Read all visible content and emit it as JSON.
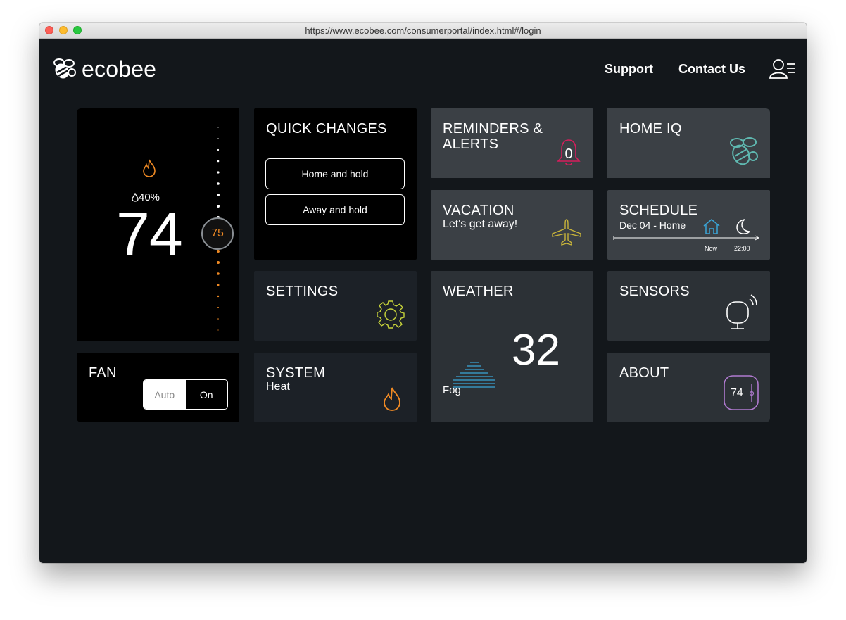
{
  "browser": {
    "url": "https://www.ecobee.com/consumerportal/index.html#/login"
  },
  "header": {
    "brand": "ecobee",
    "links": {
      "support": "Support",
      "contact": "Contact Us"
    },
    "icons": {
      "logo": "bee-logo-icon",
      "user": "user-menu-icon"
    }
  },
  "thermostat": {
    "current_temp": "74",
    "humidity": "40%",
    "setpoint": "75",
    "mode_icon": "flame-icon",
    "colors": {
      "heat": "#f08a24",
      "dial": "#ffffff"
    }
  },
  "fan": {
    "title": "FAN",
    "options": [
      "Auto",
      "On"
    ],
    "selected": "Auto"
  },
  "quick_changes": {
    "title": "QUICK CHANGES",
    "buttons": [
      "Home and hold",
      "Away and hold"
    ]
  },
  "settings": {
    "title": "SETTINGS",
    "icon": "gear-icon",
    "icon_color": "#c8d43a"
  },
  "system": {
    "title": "SYSTEM",
    "subtitle": "Heat",
    "icon": "flame-icon",
    "icon_color": "#f08a24"
  },
  "reminders": {
    "title_line1": "REMINDERS &",
    "title_line2": "ALERTS",
    "count": "0",
    "icon": "bell-icon",
    "icon_color": "#d41e5c"
  },
  "vacation": {
    "title": "VACATION",
    "subtitle": "Let's get away!",
    "icon": "airplane-icon",
    "icon_color": "#c8b43a"
  },
  "weather": {
    "title": "WEATHER",
    "temp": "32",
    "condition": "Fog",
    "icon": "fog-icon",
    "icon_color": "#3aa6d8"
  },
  "home_iq": {
    "title": "HOME IQ",
    "icon": "bee-icon",
    "icon_color": "#5fb8b0"
  },
  "schedule": {
    "title": "SCHEDULE",
    "subtitle": "Dec 04 - Home",
    "now_label": "Now",
    "time_label": "22:00",
    "icons": [
      "home-icon",
      "moon-icon"
    ],
    "home_color": "#3aa6d8"
  },
  "sensors": {
    "title": "SENSORS",
    "icon": "sensor-icon"
  },
  "about": {
    "title": "ABOUT",
    "device_temp": "74",
    "icon": "thermostat-device-icon",
    "icon_color": "#b07ad0"
  }
}
